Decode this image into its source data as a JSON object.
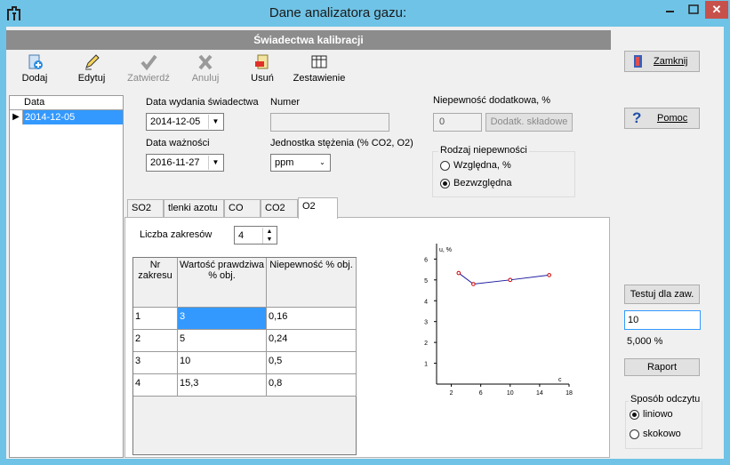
{
  "window": {
    "title": "Dane analizatora gazu:",
    "close_glyph": "✕"
  },
  "header": {
    "title": "Świadectwa kalibracji"
  },
  "toolbar": {
    "add": "Dodaj",
    "edit": "Edytuj",
    "approve": "Zatwierdź",
    "cancel": "Anuluj",
    "delete": "Usuń",
    "summary": "Zestawienie"
  },
  "list": {
    "header": "Data",
    "marker": "▶",
    "rows": [
      "2014-12-05"
    ]
  },
  "form": {
    "issue_date_label": "Data wydania świadectwa",
    "issue_date": "2014-12-05",
    "number_label": "Numer",
    "number_value": "",
    "validity_label": "Data ważności",
    "validity_date": "2016-11-27",
    "unit_label": "Jednostka stężenia  (% CO2, O2)",
    "unit_value": "ppm",
    "extra_unc_label": "Niepewność dodatkowa, %",
    "extra_unc_value": "0",
    "extra_unc_button": "Dodatk. składowe",
    "unc_type_label": "Rodzaj niepewności",
    "unc_relative": "Względna, %",
    "unc_absolute": "Bezwzględna",
    "unc_selected": "Bezwzględna"
  },
  "tabs": [
    "SO2",
    "tlenki azotu",
    "CO",
    "CO2",
    "O2"
  ],
  "active_tab": "O2",
  "ranges": {
    "count_label": "Liczba zakresów",
    "count": "4",
    "columns": [
      "Nr zakresu",
      "Wartość prawdziwa % obj.",
      "Niepewność % obj."
    ],
    "rows": [
      {
        "nr": "1",
        "value": "3",
        "unc": "0,16"
      },
      {
        "nr": "2",
        "value": "5",
        "unc": "0,24"
      },
      {
        "nr": "3",
        "value": "10",
        "unc": "0,5"
      },
      {
        "nr": "4",
        "value": "15,3",
        "unc": "0,8"
      }
    ]
  },
  "chart_data": {
    "type": "line",
    "ylabel": "u, %",
    "xlabel": "c",
    "xlim": [
      0,
      18
    ],
    "ylim": [
      1,
      6
    ],
    "xticks": [
      "2",
      "6",
      "10",
      "14",
      "18"
    ],
    "yticks": [
      "1",
      "2",
      "3",
      "4",
      "5",
      "6"
    ],
    "series": [
      {
        "x": [
          3,
          5,
          10,
          15.3
        ],
        "y": [
          5.33,
          4.8,
          5.0,
          5.23
        ],
        "color": "#1a1aa0",
        "marker_color": "#cc0000"
      }
    ]
  },
  "side": {
    "close": "Zamknij",
    "help": "Pomoc",
    "test_button": "Testuj dla zaw.",
    "test_value": "10",
    "test_result": "5,000 %",
    "report": "Raport",
    "read_method_label": "Sposób odczytu",
    "linear": "liniowo",
    "step": "skokowo",
    "read_selected": "liniowo"
  }
}
